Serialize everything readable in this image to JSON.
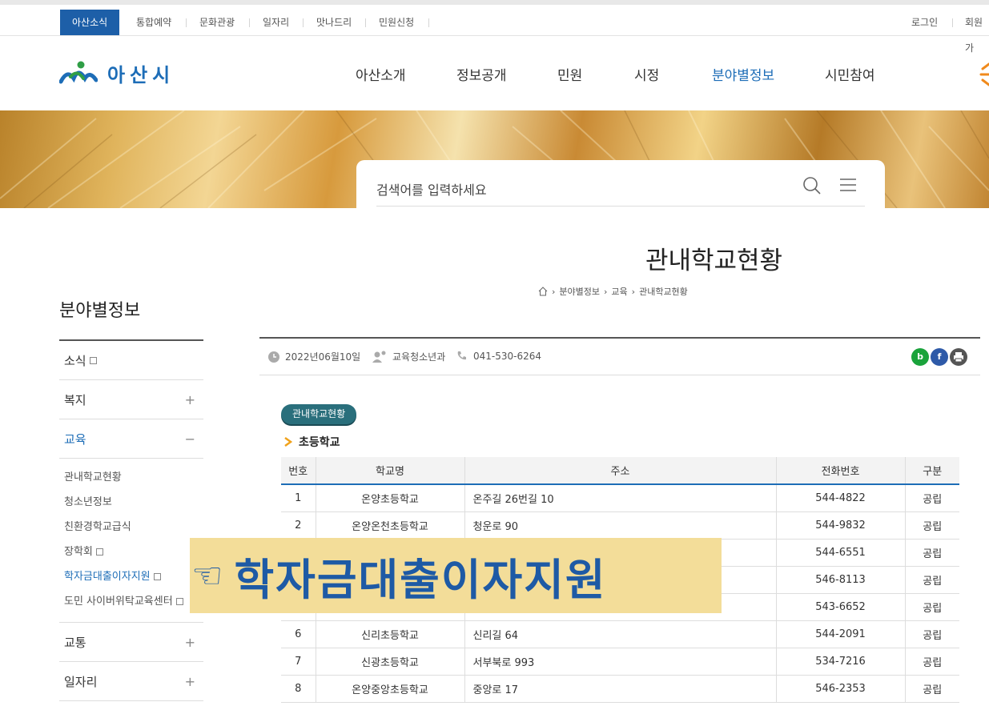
{
  "util": {
    "left": [
      "아산소식",
      "통합예약",
      "문화관광",
      "일자리",
      "맛나드리",
      "민원신청"
    ],
    "login": "로그인",
    "join": "회원가"
  },
  "logo": {
    "text": "아산시"
  },
  "gnb": [
    "아산소개",
    "정보공개",
    "민원",
    "시정",
    "분야별정보",
    "시민참여"
  ],
  "search": {
    "placeholder": "검색어를 입력하세요"
  },
  "page": {
    "title": "관내학교현황",
    "breadcrumb": [
      "분야별정보",
      "교육",
      "관내학교현황"
    ]
  },
  "lnb": {
    "title": "분야별정보",
    "items": [
      {
        "label": "소식",
        "sign": ""
      },
      {
        "label": "복지",
        "sign": "+"
      },
      {
        "label": "교육",
        "sign": "−"
      }
    ],
    "sub": [
      "관내학교현황",
      "청소년정보",
      "친환경학교급식",
      "장학회",
      "학자금대출이자지원",
      "도민 사이버위탁교육센터"
    ],
    "after": [
      {
        "label": "교통",
        "sign": "+"
      },
      {
        "label": "일자리",
        "sign": "+"
      }
    ]
  },
  "meta": {
    "date": "2022년06월10일",
    "dept": "교육청소년과",
    "phone": "041-530-6264"
  },
  "sns": {
    "blog": "b",
    "facebook": "f"
  },
  "badge": "관내학교현황",
  "section": "초등학교",
  "table": {
    "headers": [
      "번호",
      "학교명",
      "주소",
      "전화번호",
      "구분"
    ],
    "rows": [
      [
        "1",
        "온양초등학교",
        "온주길 26번길 10",
        "544-4822",
        "공립"
      ],
      [
        "2",
        "온양온천초등학교",
        "청운로 90",
        "544-9832",
        "공립"
      ],
      [
        "",
        "",
        "",
        "544-6551",
        "공립"
      ],
      [
        "",
        "",
        "",
        "546-8113",
        "공립"
      ],
      [
        "",
        "",
        "",
        "543-6652",
        "공립"
      ],
      [
        "6",
        "신리초등학교",
        "신리길 64",
        "544-2091",
        "공립"
      ],
      [
        "7",
        "신광초등학교",
        "서부북로 993",
        "534-7216",
        "공립"
      ],
      [
        "8",
        "온양중앙초등학교",
        "중앙로 17",
        "546-2353",
        "공립"
      ]
    ]
  },
  "overlay": {
    "hand": "☜",
    "text": "학자금대출이자지원"
  },
  "colors": {
    "accent": "#1d6db7",
    "util_active": "#1d5fa8",
    "overlay_bg": "#f3dd99"
  }
}
